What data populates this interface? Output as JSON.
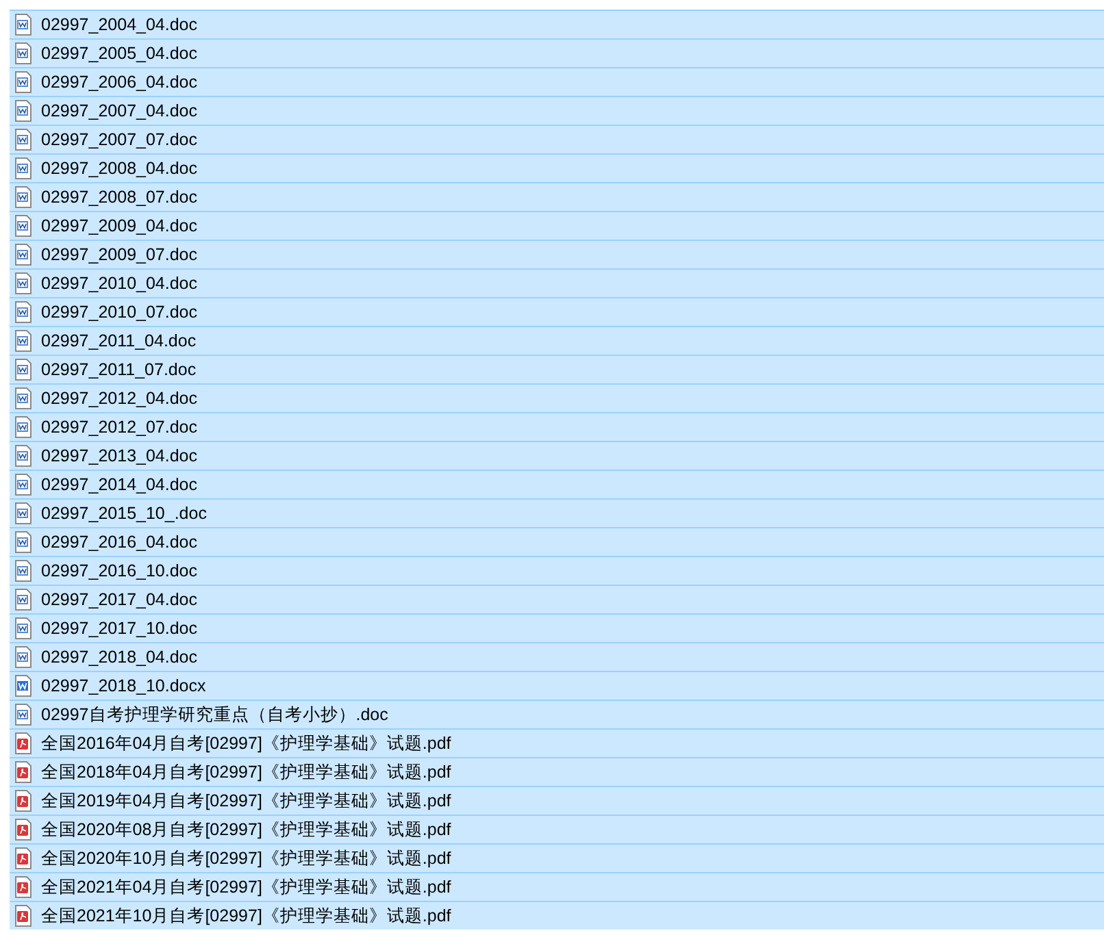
{
  "files": [
    {
      "name": "02997_2004_04.doc",
      "kind": "doc",
      "selected": true
    },
    {
      "name": "02997_2005_04.doc",
      "kind": "doc",
      "selected": true
    },
    {
      "name": "02997_2006_04.doc",
      "kind": "doc",
      "selected": true
    },
    {
      "name": "02997_2007_04.doc",
      "kind": "doc",
      "selected": true
    },
    {
      "name": "02997_2007_07.doc",
      "kind": "doc",
      "selected": true
    },
    {
      "name": "02997_2008_04.doc",
      "kind": "doc",
      "selected": true
    },
    {
      "name": "02997_2008_07.doc",
      "kind": "doc",
      "selected": true
    },
    {
      "name": "02997_2009_04.doc",
      "kind": "doc",
      "selected": true
    },
    {
      "name": "02997_2009_07.doc",
      "kind": "doc",
      "selected": true
    },
    {
      "name": "02997_2010_04.doc",
      "kind": "doc",
      "selected": true
    },
    {
      "name": "02997_2010_07.doc",
      "kind": "doc",
      "selected": true
    },
    {
      "name": "02997_2011_04.doc",
      "kind": "doc",
      "selected": true
    },
    {
      "name": "02997_2011_07.doc",
      "kind": "doc",
      "selected": true
    },
    {
      "name": "02997_2012_04.doc",
      "kind": "doc",
      "selected": true
    },
    {
      "name": "02997_2012_07.doc",
      "kind": "doc",
      "selected": true
    },
    {
      "name": "02997_2013_04.doc",
      "kind": "doc",
      "selected": true
    },
    {
      "name": "02997_2014_04.doc",
      "kind": "doc",
      "selected": true
    },
    {
      "name": "02997_2015_10_.doc",
      "kind": "doc",
      "selected": true
    },
    {
      "name": "02997_2016_04.doc",
      "kind": "doc",
      "selected": true
    },
    {
      "name": "02997_2016_10.doc",
      "kind": "doc",
      "selected": true
    },
    {
      "name": "02997_2017_04.doc",
      "kind": "doc",
      "selected": true
    },
    {
      "name": "02997_2017_10.doc",
      "kind": "doc",
      "selected": true
    },
    {
      "name": "02997_2018_04.doc",
      "kind": "doc",
      "selected": true
    },
    {
      "name": "02997_2018_10.docx",
      "kind": "docx",
      "selected": true
    },
    {
      "name": "02997自考护理学研究重点（自考小抄）.doc",
      "kind": "doc",
      "selected": true
    },
    {
      "name": "全国2016年04月自考[02997]《护理学基础》试题.pdf",
      "kind": "pdf",
      "selected": true
    },
    {
      "name": "全国2018年04月自考[02997]《护理学基础》试题.pdf",
      "kind": "pdf",
      "selected": true
    },
    {
      "name": "全国2019年04月自考[02997]《护理学基础》试题.pdf",
      "kind": "pdf",
      "selected": true
    },
    {
      "name": "全国2020年08月自考[02997]《护理学基础》试题.pdf",
      "kind": "pdf",
      "selected": true
    },
    {
      "name": "全国2020年10月自考[02997]《护理学基础》试题.pdf",
      "kind": "pdf",
      "selected": true
    },
    {
      "name": "全国2021年04月自考[02997]《护理学基础》试题.pdf",
      "kind": "pdf",
      "selected": true
    },
    {
      "name": "全国2021年10月自考[02997]《护理学基础》试题.pdf",
      "kind": "pdf",
      "selected": true
    }
  ]
}
